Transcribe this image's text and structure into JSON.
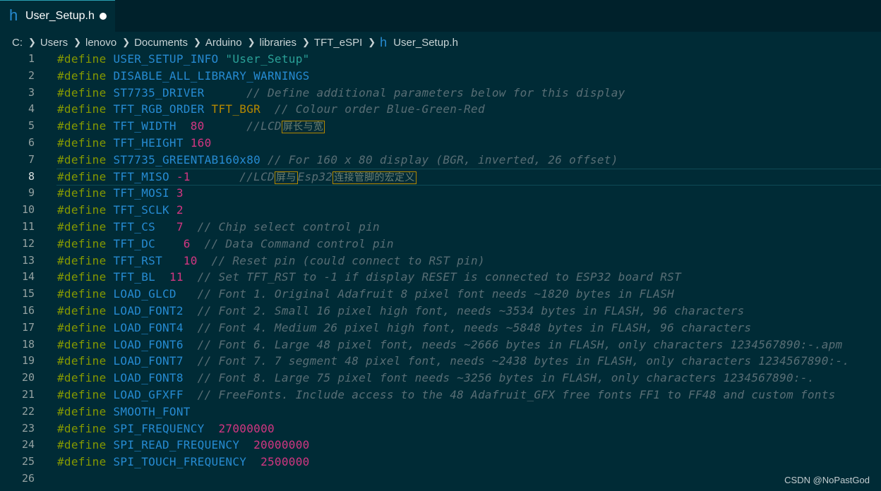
{
  "tab": {
    "icon": "h",
    "title": "User_Setup.h"
  },
  "breadcrumb": {
    "items": [
      "C:",
      "Users",
      "lenovo",
      "Documents",
      "Arduino",
      "libraries",
      "TFT_eSPI"
    ],
    "file_icon": "h",
    "file": "User_Setup.h"
  },
  "editor": {
    "current_line": 8,
    "lines": [
      [
        [
          "kw",
          "#define "
        ],
        [
          "mac",
          "USER_SETUP_INFO "
        ],
        [
          "str",
          "\"User_Setup\""
        ]
      ],
      [
        [
          "kw",
          "#define "
        ],
        [
          "mac",
          "DISABLE_ALL_LIBRARY_WARNINGS"
        ]
      ],
      [
        [
          "kw",
          "#define "
        ],
        [
          "mac",
          "ST7735_DRIVER      "
        ],
        [
          "cm",
          "// Define additional parameters below for this display"
        ]
      ],
      [
        [
          "kw",
          "#define "
        ],
        [
          "mac",
          "TFT_RGB_ORDER "
        ],
        [
          "bgr",
          "TFT_BGR"
        ],
        [
          "cm",
          "  // Colour order Blue-Green-Red"
        ]
      ],
      [
        [
          "kw",
          "#define "
        ],
        [
          "mac",
          "TFT_WIDTH  "
        ],
        [
          "num",
          "80"
        ],
        [
          "cm",
          "      //LCD"
        ],
        [
          "cjk",
          "屏长与宽"
        ]
      ],
      [
        [
          "kw",
          "#define "
        ],
        [
          "mac",
          "TFT_HEIGHT "
        ],
        [
          "num",
          "160"
        ]
      ],
      [
        [
          "kw",
          "#define "
        ],
        [
          "mac",
          "ST7735_GREENTAB160x80 "
        ],
        [
          "cm",
          "// For 160 x 80 display (BGR, inverted, 26 offset)"
        ]
      ],
      [
        [
          "kw",
          "#define "
        ],
        [
          "mac",
          "TFT_MISO "
        ],
        [
          "num",
          "-1"
        ],
        [
          "cm",
          "       //LCD"
        ],
        [
          "cjk",
          "屏与"
        ],
        [
          "cm",
          "Esp32"
        ],
        [
          "cjk",
          "连接管脚的宏定义"
        ]
      ],
      [
        [
          "kw",
          "#define "
        ],
        [
          "mac",
          "TFT_MOSI "
        ],
        [
          "num",
          "3"
        ]
      ],
      [
        [
          "kw",
          "#define "
        ],
        [
          "mac",
          "TFT_SCLK "
        ],
        [
          "num",
          "2"
        ]
      ],
      [
        [
          "kw",
          "#define "
        ],
        [
          "mac",
          "TFT_CS   "
        ],
        [
          "num",
          "7"
        ],
        [
          "cm",
          "  // Chip select control pin"
        ]
      ],
      [
        [
          "kw",
          "#define "
        ],
        [
          "mac",
          "TFT_DC    "
        ],
        [
          "num",
          "6"
        ],
        [
          "cm",
          "  // Data Command control pin"
        ]
      ],
      [
        [
          "kw",
          "#define "
        ],
        [
          "mac",
          "TFT_RST   "
        ],
        [
          "num",
          "10"
        ],
        [
          "cm",
          "  // Reset pin (could connect to RST pin)"
        ]
      ],
      [
        [
          "kw",
          "#define "
        ],
        [
          "mac",
          "TFT_BL  "
        ],
        [
          "num",
          "11"
        ],
        [
          "cm",
          "  // Set TFT_RST to -1 if display RESET is connected to ESP32 board RST"
        ]
      ],
      [
        [
          "kw",
          "#define "
        ],
        [
          "mac",
          "LOAD_GLCD   "
        ],
        [
          "cm",
          "// Font 1. Original Adafruit 8 pixel font needs ~1820 bytes in FLASH"
        ]
      ],
      [
        [
          "kw",
          "#define "
        ],
        [
          "mac",
          "LOAD_FONT2  "
        ],
        [
          "cm",
          "// Font 2. Small 16 pixel high font, needs ~3534 bytes in FLASH, 96 characters"
        ]
      ],
      [
        [
          "kw",
          "#define "
        ],
        [
          "mac",
          "LOAD_FONT4  "
        ],
        [
          "cm",
          "// Font 4. Medium 26 pixel high font, needs ~5848 bytes in FLASH, 96 characters"
        ]
      ],
      [
        [
          "kw",
          "#define "
        ],
        [
          "mac",
          "LOAD_FONT6  "
        ],
        [
          "cm",
          "// Font 6. Large 48 pixel font, needs ~2666 bytes in FLASH, only characters 1234567890:-.apm"
        ]
      ],
      [
        [
          "kw",
          "#define "
        ],
        [
          "mac",
          "LOAD_FONT7  "
        ],
        [
          "cm",
          "// Font 7. 7 segment 48 pixel font, needs ~2438 bytes in FLASH, only characters 1234567890:-."
        ]
      ],
      [
        [
          "kw",
          "#define "
        ],
        [
          "mac",
          "LOAD_FONT8  "
        ],
        [
          "cm",
          "// Font 8. Large 75 pixel font needs ~3256 bytes in FLASH, only characters 1234567890:-."
        ]
      ],
      [
        [
          "kw",
          "#define "
        ],
        [
          "mac",
          "LOAD_GFXFF  "
        ],
        [
          "cm",
          "// FreeFonts. Include access to the 48 Adafruit_GFX free fonts FF1 to FF48 and custom fonts"
        ]
      ],
      [
        [
          "kw",
          "#define "
        ],
        [
          "mac",
          "SMOOTH_FONT"
        ]
      ],
      [
        [
          "kw",
          "#define "
        ],
        [
          "mac",
          "SPI_FREQUENCY  "
        ],
        [
          "num",
          "27000000"
        ]
      ],
      [
        [
          "kw",
          "#define "
        ],
        [
          "mac",
          "SPI_READ_FREQUENCY  "
        ],
        [
          "num",
          "20000000"
        ]
      ],
      [
        [
          "kw",
          "#define "
        ],
        [
          "mac",
          "SPI_TOUCH_FREQUENCY  "
        ],
        [
          "num",
          "2500000"
        ]
      ],
      []
    ]
  },
  "watermark": "CSDN @NoPastGod",
  "colors": {
    "background": "#002b36",
    "keyword": "#859900",
    "macro": "#268bd2",
    "string": "#2aa198",
    "number": "#d33682",
    "constant": "#b58900",
    "comment": "#586e75"
  }
}
